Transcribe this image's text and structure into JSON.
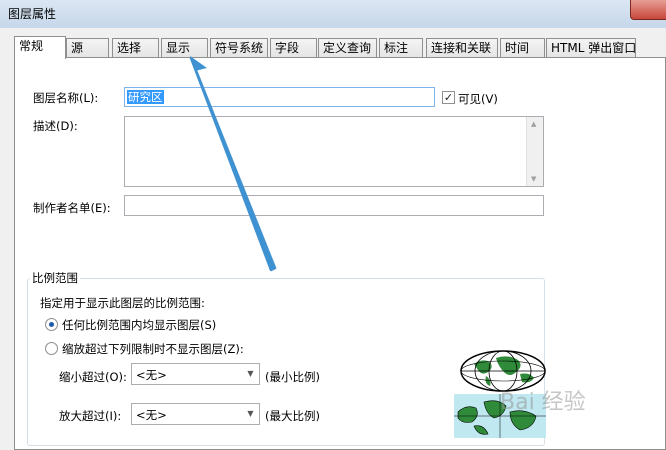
{
  "window": {
    "title": "图层属性"
  },
  "tabs": [
    {
      "label": "常规",
      "active": true
    },
    {
      "label": "源"
    },
    {
      "label": "选择"
    },
    {
      "label": "显示"
    },
    {
      "label": "符号系统"
    },
    {
      "label": "字段"
    },
    {
      "label": "定义查询"
    },
    {
      "label": "标注"
    },
    {
      "label": "连接和关联"
    },
    {
      "label": "时间"
    },
    {
      "label": "HTML 弹出窗口"
    }
  ],
  "general": {
    "layer_name_label": "图层名称(L):",
    "layer_name_value": "研究区",
    "visible_label": "可见(V)",
    "visible_checked": "✓",
    "description_label": "描述(D):",
    "credits_label": "制作者名单(E):"
  },
  "scale_range": {
    "title": "比例范围",
    "instruction": "指定用于显示此图层的比例范围:",
    "option_any": "任何比例范围内均显示图层(S)",
    "option_limit": "缩放超过下列限制时不显示图层(Z):",
    "out_beyond_label": "缩小超过(O):",
    "out_beyond_value": "<无>",
    "min_scale": "(最小比例)",
    "in_beyond_label": "放大超过(I):",
    "in_beyond_value": "<无>",
    "max_scale": "(最大比例)"
  },
  "watermark": "Bai 经验",
  "colors": {
    "accent_arrow": "#3f92d2",
    "selection": "#3399ff"
  }
}
